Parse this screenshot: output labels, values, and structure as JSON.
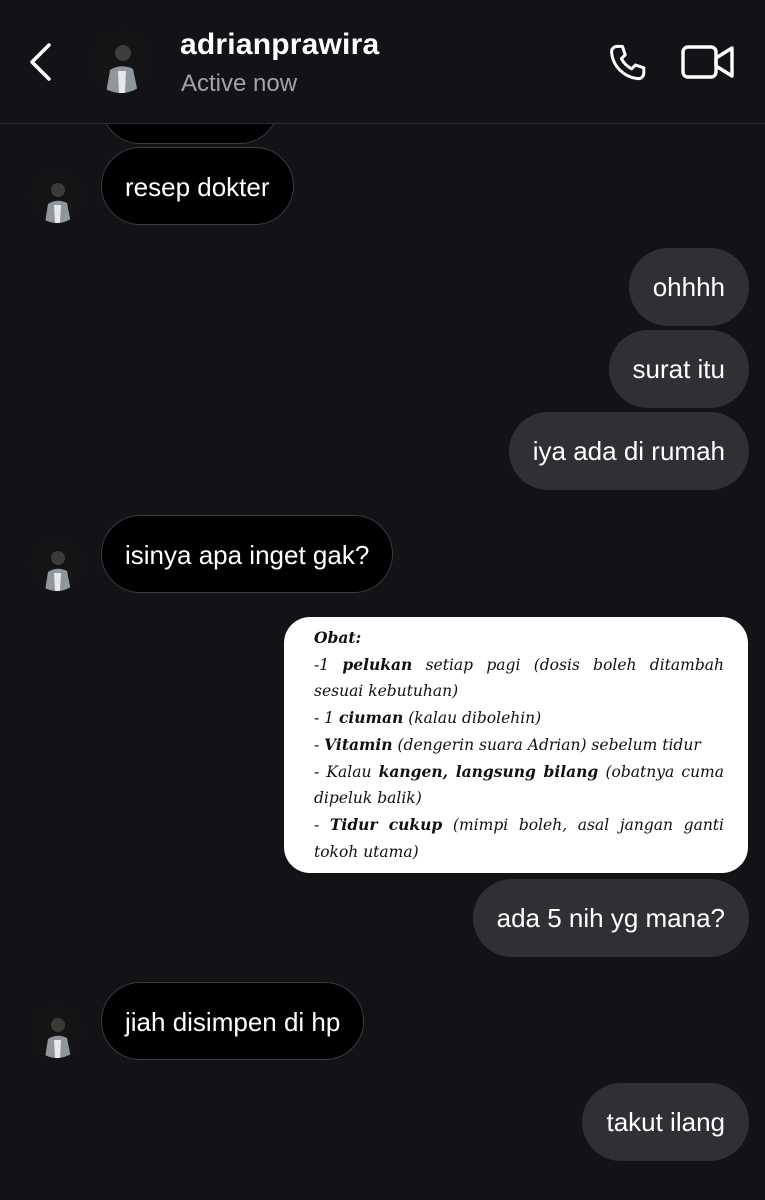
{
  "header": {
    "username": "adrianprawira",
    "status": "Active now",
    "back_icon": "chevron-left-icon",
    "call_icon": "phone-icon",
    "video_icon": "video-camera-icon"
  },
  "colors": {
    "background": "#121217",
    "incoming_bubble": "#000000",
    "incoming_border": "#3b3b41",
    "outgoing_bubble": "#2f2f34",
    "status_text": "#a2a2a8"
  },
  "messages": [
    {
      "from": "them",
      "text": "resep dokter"
    },
    {
      "from": "me",
      "text": "ohhhh"
    },
    {
      "from": "me",
      "text": "surat itu"
    },
    {
      "from": "me",
      "text": "iya ada di rumah"
    },
    {
      "from": "them",
      "text": "isinya apa inget gak?"
    },
    {
      "from": "me",
      "type": "image-note"
    },
    {
      "from": "me",
      "text": "ada 5 nih yg mana?"
    },
    {
      "from": "them",
      "text": "jiah disimpen di hp"
    },
    {
      "from": "me",
      "text": "takut ilang"
    }
  ],
  "note": {
    "title": "Obat:",
    "l1_pre": "-1 ",
    "l1_bold": "pelukan",
    "l1_post": " setiap pagi (dosis boleh ditambah sesuai kebutuhan)",
    "l2_pre": "- 1 ",
    "l2_bold": "ciuman",
    "l2_post": " (kalau dibolehin)",
    "l3_pre": "- ",
    "l3_bold": "Vitamin",
    "l3_post": " (dengerin suara Adrian) sebelum tidur",
    "l4_pre": "- Kalau ",
    "l4_bold": "kangen, langsung bilang",
    "l4_post": " (obatnya cuma dipeluk balik)",
    "l5_pre": "- ",
    "l5_bold": "Tidur cukup",
    "l5_post": " (mimpi boleh, asal jangan ganti tokoh utama)"
  }
}
